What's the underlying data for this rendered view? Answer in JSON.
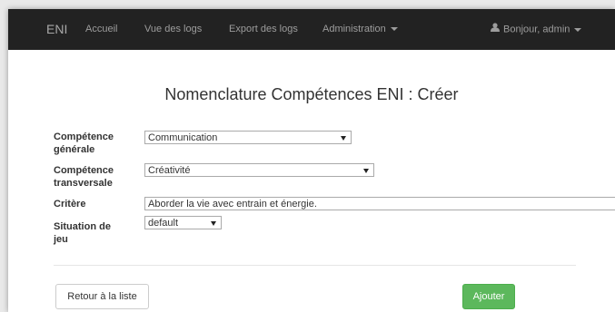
{
  "navbar": {
    "brand": "ENI",
    "items": [
      "Accueil",
      "Vue des logs",
      "Export des logs",
      "Administration"
    ],
    "user_label": "Bonjour, admin"
  },
  "page": {
    "title": "Nomenclature Compétences ENI : Créer"
  },
  "form": {
    "competence_generale": {
      "label_line1": "Compétence",
      "label_line2": "générale",
      "value": "Communication"
    },
    "competence_transversale": {
      "label_line1": "Compétence",
      "label_line2": "transversale",
      "value": "Créativité"
    },
    "critere": {
      "label": "Critère",
      "value": "Aborder la vie avec entrain et énergie."
    },
    "situation_de_jeu": {
      "label_line1": "Situation de",
      "label_line2": "jeu",
      "value": "default"
    }
  },
  "buttons": {
    "back": "Retour à la liste",
    "add": "Ajouter"
  },
  "colors": {
    "navbar_bg": "#222222",
    "success": "#5cb85c"
  }
}
